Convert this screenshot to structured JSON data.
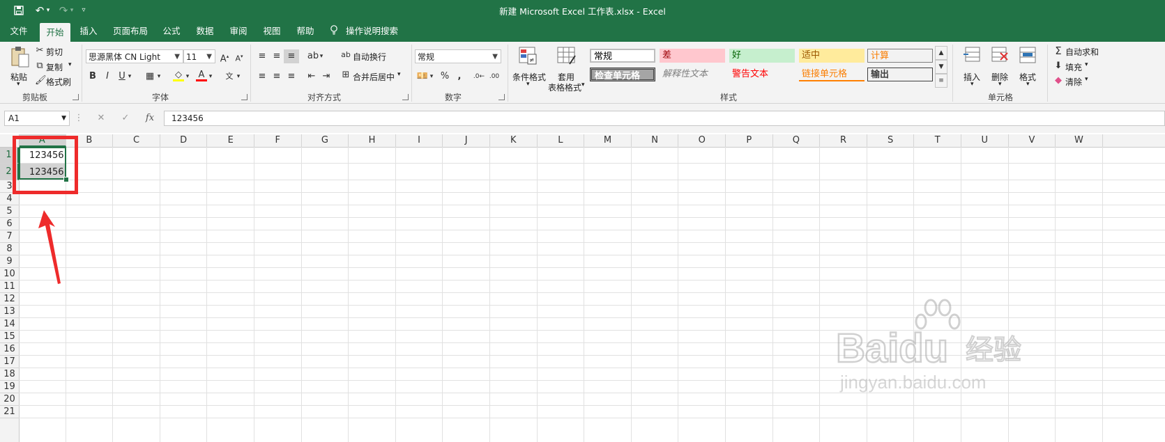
{
  "window": {
    "title": "新建 Microsoft Excel 工作表.xlsx  -  Excel"
  },
  "quick_access": {
    "icons": [
      "save-icon",
      "undo-icon",
      "redo-icon",
      "customize-icon"
    ]
  },
  "tabs": [
    {
      "label": "文件"
    },
    {
      "label": "开始",
      "active": true
    },
    {
      "label": "插入"
    },
    {
      "label": "页面布局"
    },
    {
      "label": "公式"
    },
    {
      "label": "数据"
    },
    {
      "label": "审阅"
    },
    {
      "label": "视图"
    },
    {
      "label": "帮助"
    }
  ],
  "tell_me": "操作说明搜索",
  "ribbon": {
    "clipboard": {
      "paste": "粘贴",
      "cut": "剪切",
      "copy": "复制",
      "format_painter": "格式刷",
      "label": "剪贴板"
    },
    "font": {
      "name": "思源黑体 CN Light",
      "size": "11",
      "bold": "B",
      "italic": "I",
      "underline": "U",
      "label": "字体"
    },
    "alignment": {
      "wrap": "自动换行",
      "merge": "合并后居中",
      "label": "对齐方式"
    },
    "number": {
      "format": "常规",
      "percent": "%",
      "comma": ",",
      "label": "数字"
    },
    "styles": {
      "conditional": "条件格式",
      "table_line1": "套用",
      "table_line2": "表格格式",
      "label": "样式",
      "gallery": [
        {
          "text": "常规",
          "color": "#000000",
          "bg": "#ffffff"
        },
        {
          "text": "差",
          "color": "#9c0006",
          "bg": "#ffc7ce"
        },
        {
          "text": "好",
          "color": "#006100",
          "bg": "#c6efce"
        },
        {
          "text": "适中",
          "color": "#9c5700",
          "bg": "#ffeb9c"
        },
        {
          "text": "计算",
          "color": "#fa7d00",
          "bg": "#f2f2f2"
        },
        {
          "text": "检查单元格",
          "color": "#ffffff",
          "bg": "#a5a5a5"
        },
        {
          "text": "解释性文本",
          "color": "#7f7f7f",
          "bg": "#ffffff"
        },
        {
          "text": "警告文本",
          "color": "#ff0000",
          "bg": "#ffffff"
        },
        {
          "text": "链接单元格",
          "color": "#fa7d00",
          "bg": "#ffffff"
        },
        {
          "text": "输出",
          "color": "#3f3f3f",
          "bg": "#f2f2f2"
        }
      ]
    },
    "cells": {
      "insert": "插入",
      "delete": "删除",
      "format": "格式",
      "label": "单元格"
    },
    "editing": {
      "autosum": "自动求和",
      "fill": "填充",
      "clear": "清除"
    }
  },
  "formula_bar": {
    "name_box": "A1",
    "fx": "fx",
    "value": "123456"
  },
  "sheet": {
    "columns": [
      "A",
      "B",
      "C",
      "D",
      "E",
      "F",
      "G",
      "H",
      "I",
      "J",
      "K",
      "L",
      "M",
      "N",
      "O",
      "P",
      "Q",
      "R",
      "S",
      "T",
      "U",
      "V",
      "W"
    ],
    "rows": [
      "1",
      "2",
      "3",
      "4",
      "5",
      "6",
      "7",
      "8",
      "9",
      "10",
      "11",
      "12",
      "13",
      "14",
      "15",
      "16",
      "17",
      "18",
      "19",
      "20",
      "21"
    ],
    "selected_column": "A",
    "selected_rows": [
      "1",
      "2"
    ],
    "cells": [
      {
        "ref": "A1",
        "value": "123456"
      },
      {
        "ref": "A2",
        "value": "123456"
      }
    ]
  },
  "watermark": {
    "brand": "Baidu",
    "suffix": "经验",
    "url": "jingyan.baidu.com"
  },
  "colors": {
    "excel_green": "#217346",
    "annotation_red": "#ee2b2b"
  }
}
